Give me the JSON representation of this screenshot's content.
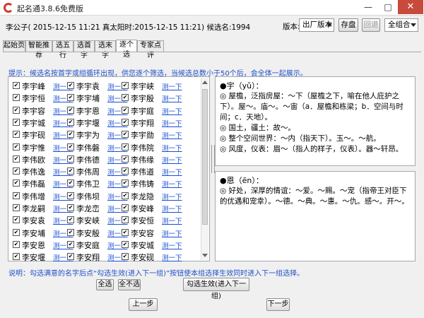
{
  "window": {
    "title": "起名通3.8.6免费版",
    "min_glyph": "—",
    "max_glyph": "□",
    "close_glyph": "✕"
  },
  "header": {
    "info": "李公子( 2015-12-15 11:21 真太阳时:2015-12-15 11:21) 候选名:1994",
    "version_label": "版本:",
    "version_value": "出厂版本",
    "save_label": "存盘",
    "back_label": "回退",
    "combo_value": "全组合"
  },
  "tabs": [
    "起始页",
    "智能推荐",
    "选五行",
    "选首字",
    "选末字",
    "逐个选",
    "专家点评"
  ],
  "tip": "提示：候选名按首字或组循环出现，供您逐个筛选，当候选总数小于50个后，会全体一起展示。",
  "names": {
    "check_glyph": "✔",
    "link_label": "测一下",
    "rows": [
      [
        "李宇峰",
        "李宇袁",
        "李宇峡"
      ],
      [
        "李宇恒",
        "李宇埔",
        "李宇殷"
      ],
      [
        "李宇容",
        "李宇恩",
        "李宇庭"
      ],
      [
        "李宇城",
        "李宇堰",
        "李宇翔"
      ],
      [
        "李宇砚",
        "李宇为",
        "李宇勋"
      ],
      [
        "李宇惟",
        "李伟磐",
        "李伟院"
      ],
      [
        "李伟欧",
        "李伟德",
        "李伟缘"
      ],
      [
        "李伟逸",
        "李伟周",
        "李伟道"
      ],
      [
        "李伟磊",
        "李伟卫",
        "李伟铸"
      ],
      [
        "李伟增",
        "李伟坝",
        "李龙隐"
      ],
      [
        "李龙嗣",
        "李龙峦",
        "李安峰"
      ],
      [
        "李安袁",
        "李安峡",
        "李安恒"
      ],
      [
        "李安埔",
        "李安殷",
        "李安容"
      ],
      [
        "李安恩",
        "李安庭",
        "李安城"
      ],
      [
        "李安堰",
        "李安翔",
        "李安砚"
      ]
    ]
  },
  "def1": {
    "head": "●宇（yǔ）：",
    "lines": [
      "◎ 屋檐，泛指房屋：～下（屋檐之下，喻在他人庇护之下）。屋～。庙～。～宙（a．屋檐和栋梁；b．空间与时间；c．天地）。",
      "◎ 国土，疆土：故～。",
      "◎ 整个空间世界：～内（指天下）。玉～。～航。",
      "◎ 风度，仪表：眉～（指人的样子，仪表）。器～轩昂。"
    ]
  },
  "def2": {
    "head": "●恩（ēn）：",
    "lines": [
      "◎ 好处，深厚的情谊：～爱。～赐。～宠（指帝王对臣下的优遇和宠幸）。～德。～典。～惠。～仇。感～。开～。"
    ]
  },
  "footer": {
    "note": "说明：勾选满意的名字后点“勾选生效(进入下一组)”按钮使本组选择生效同时进入下一组选择。",
    "select_all": "全选",
    "select_none": "全不选",
    "apply": "勾选生效(进入下一组)",
    "prev": "上一步",
    "next": "下一步"
  }
}
